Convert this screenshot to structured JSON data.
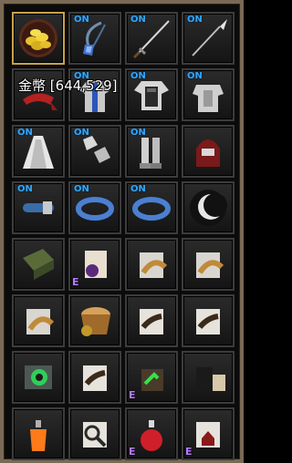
{
  "currency": {
    "label": "金幣",
    "value": "[644,529]"
  },
  "colors": {
    "on_tag": "#2ea7ff",
    "enchant_tag": "#b67bff",
    "frame": "#7a6a55"
  },
  "on_tag_text": "ON",
  "enchant_tag_text": "E",
  "slots": [
    {
      "name": "gold-coins-icon",
      "on": false,
      "e": false
    },
    {
      "name": "blue-amulet-icon",
      "on": true,
      "e": false
    },
    {
      "name": "long-sword-icon",
      "on": true,
      "e": false
    },
    {
      "name": "spear-icon",
      "on": true,
      "e": false
    },
    {
      "name": "red-headband-icon",
      "on": false,
      "e": false
    },
    {
      "name": "blue-tunic-icon",
      "on": true,
      "e": false
    },
    {
      "name": "dark-cuirass-icon",
      "on": true,
      "e": false
    },
    {
      "name": "plate-armor-icon",
      "on": true,
      "e": false
    },
    {
      "name": "white-cloak-icon",
      "on": true,
      "e": false
    },
    {
      "name": "gauntlets-icon",
      "on": true,
      "e": false
    },
    {
      "name": "greaves-icon",
      "on": true,
      "e": false
    },
    {
      "name": "crimson-helm-icon",
      "on": false,
      "e": false
    },
    {
      "name": "leather-belt-icon",
      "on": true,
      "e": false
    },
    {
      "name": "rune-ring-icon",
      "on": true,
      "e": false
    },
    {
      "name": "rune-ring-icon",
      "on": true,
      "e": false
    },
    {
      "name": "moon-orb-icon",
      "on": false,
      "e": false
    },
    {
      "name": "green-spellbook-icon",
      "on": false,
      "e": false
    },
    {
      "name": "purple-scroll-icon",
      "on": false,
      "e": true
    },
    {
      "name": "horn-scroll-icon",
      "on": false,
      "e": false
    },
    {
      "name": "horn-scroll-icon",
      "on": false,
      "e": false
    },
    {
      "name": "horn-scroll-icon",
      "on": false,
      "e": false
    },
    {
      "name": "dough-pot-icon",
      "on": false,
      "e": false
    },
    {
      "name": "tattered-scroll-icon",
      "on": false,
      "e": false
    },
    {
      "name": "tattered-scroll-icon",
      "on": false,
      "e": false
    },
    {
      "name": "gear-tablet-icon",
      "on": false,
      "e": false
    },
    {
      "name": "tattered-scroll-icon",
      "on": false,
      "e": false
    },
    {
      "name": "green-arrow-pouch-icon",
      "on": false,
      "e": true
    },
    {
      "name": "jar-sacks-icon",
      "on": false,
      "e": false
    },
    {
      "name": "flame-potion-icon",
      "on": false,
      "e": false
    },
    {
      "name": "magnifier-scroll-icon",
      "on": false,
      "e": false
    },
    {
      "name": "red-potion-icon",
      "on": false,
      "e": true
    },
    {
      "name": "house-scroll-icon",
      "on": false,
      "e": true
    }
  ]
}
